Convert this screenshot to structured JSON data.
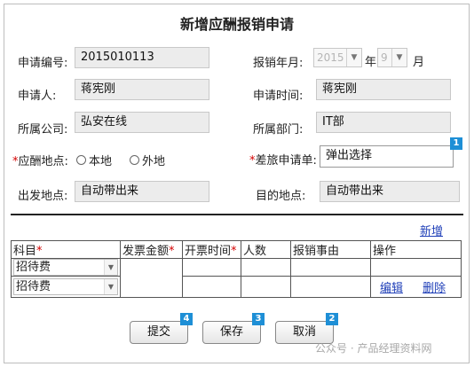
{
  "title": "新增应酬报销申请",
  "form": {
    "app_no_label": "申请编号:",
    "app_no_value": "2015010113",
    "reimburse_month_label": "报销年月:",
    "year_value": "2015",
    "year_suffix": "年",
    "month_value": "9",
    "month_suffix": "月",
    "applicant_label": "申请人:",
    "applicant_value": "蒋宪刚",
    "apply_time_label": "申请时间:",
    "apply_time_value": "蒋宪刚",
    "company_label": "所属公司:",
    "company_value": "弘安在线",
    "dept_label": "所属部门:",
    "dept_value": "IT部",
    "entertain_place_label": "应酬地点:",
    "radio_local": "本地",
    "radio_other": "外地",
    "travel_app_label": "差旅申请单:",
    "travel_app_value": "弹出选择",
    "depart_place_label": "出发地点:",
    "depart_place_value": "自动带出来",
    "dest_place_label": "目的地点:",
    "dest_place_value": "自动带出来",
    "required_mark": "*"
  },
  "detail": {
    "add_link": "新增",
    "headers": {
      "subject": "科目",
      "invoice_amount": "发票金额",
      "invoice_time": "开票时间",
      "people": "人数",
      "reason": "报销事由",
      "action": "操作"
    },
    "rows": [
      {
        "subject": "招待费"
      },
      {
        "subject": "招待费",
        "edit": "编辑",
        "delete": "删除"
      }
    ]
  },
  "buttons": {
    "submit": "提交",
    "save": "保存",
    "cancel": "取消"
  },
  "badges": {
    "travel": "1",
    "cancel": "2",
    "save": "3",
    "submit": "4"
  },
  "watermark": "公众号 · 产品经理资料网",
  "colors": {
    "badge": "#1e8fd6",
    "link": "#1f3fb8",
    "required": "#d40000"
  }
}
